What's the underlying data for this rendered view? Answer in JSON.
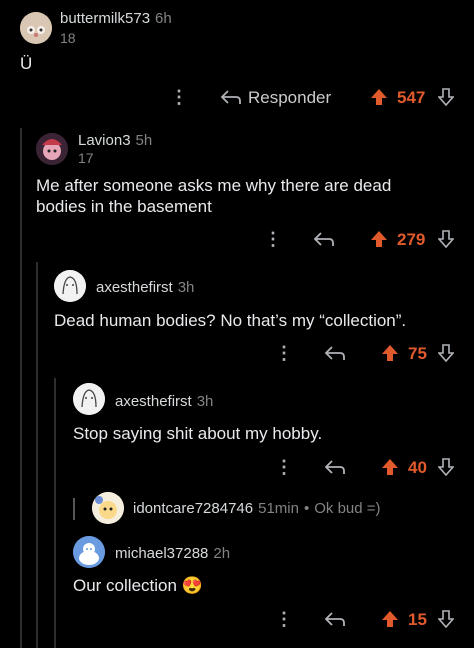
{
  "comments": [
    {
      "user": "buttermilk573",
      "time": "6h",
      "votes": "18",
      "body": "Ü",
      "reply": "Responder",
      "score": "547"
    },
    {
      "user": "Lavion3",
      "time": "5h",
      "votes": "17",
      "body1": "Me after someone asks me why there are dead",
      "body2": "bodies in the basement",
      "score": "279"
    },
    {
      "user": "axesthefirst",
      "time": "3h",
      "body": "Dead human bodies? No that’s my “collection”.",
      "score": "75"
    },
    {
      "user": "axesthefirst",
      "time": "3h",
      "body": "Stop saying shit about my hobby.",
      "score": "40"
    },
    {
      "user": "idontcare7284746",
      "time": "51min",
      "snippet": "Ok bud =)"
    },
    {
      "user": "michael37288",
      "time": "2h",
      "body": "Our collection",
      "emoji": "😍",
      "score": "15"
    }
  ],
  "colors": {
    "upvote": "#e15a2b",
    "background": "#000000",
    "text": "#d7dadc"
  },
  "icons": [
    "more-vertical-icon",
    "reply-arrow-icon",
    "upvote-arrow-icon",
    "downvote-arrow-icon",
    "avatar-icon"
  ]
}
